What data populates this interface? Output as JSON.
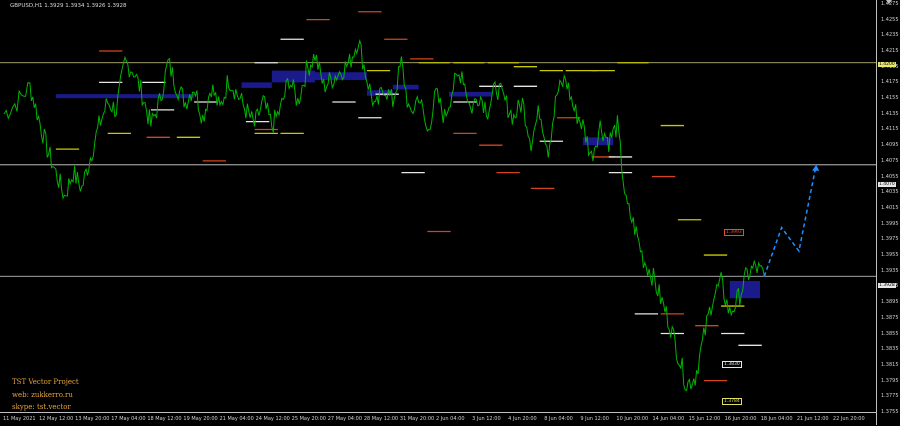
{
  "symbol_info": "GBPUSD,H1  1.3929 1.3934 1.3926 1.3928",
  "credits": [
    "TST Vector Project",
    "web: zukkerro.ru",
    "skype: tst.vector"
  ],
  "price_labels": [
    "1.4275",
    "1.4255",
    "1.4235",
    "1.4215",
    "1.4195",
    "1.4175",
    "1.4155",
    "1.4135",
    "1.4115",
    "1.4095",
    "1.4075",
    "1.4055",
    "1.4035",
    "1.4015",
    "1.3995",
    "1.3975",
    "1.3955",
    "1.3935",
    "1.3915",
    "1.3895",
    "1.3875",
    "1.3855",
    "1.3835",
    "1.3815",
    "1.3795",
    "1.3775",
    "1.3755"
  ],
  "time_labels": [
    "11 May 2021",
    "12 May 12:00",
    "13 May 20:00",
    "17 May 04:00",
    "18 May 12:00",
    "19 May 20:00",
    "21 May 04:00",
    "24 May 12:00",
    "25 May 20:00",
    "27 May 04:00",
    "28 May 12:00",
    "31 May 20:00",
    "2 Jun 04:00",
    "3 Jun 12:00",
    "4 Jun 20:00",
    "8 Jun 04:00",
    "9 Jun 12:00",
    "10 Jun 20:00",
    "14 Jun 04:00",
    "15 Jun 12:00",
    "16 Jun 20:00",
    "18 Jun 04:00",
    "21 Jun 12:00",
    "22 Jun 20:00"
  ],
  "badges": {
    "upper_line": "1.4200",
    "middle_line": "1.4070",
    "current": "1.3928",
    "target_red": "1.3993",
    "target_white": "1.3830",
    "target_yellow": "1.3784"
  },
  "colors": {
    "price": "#00b400",
    "forecast": "#1e90ff",
    "zone": "#1a1a8c",
    "level_red": "#d2451e",
    "level_yellow": "#c8c800",
    "level_white": "#e6e6e6",
    "hline": "#d9d9d9",
    "hline_yellow": "#d4d48a"
  },
  "chart_data": {
    "type": "line",
    "symbol": "GBPUSD",
    "timeframe": "H1",
    "ylim": [
      1.3755,
      1.428
    ],
    "x_range": [
      "11 May 2021",
      "22 Jun 2021"
    ],
    "horizontal_lines": [
      1.42,
      1.407,
      1.3928
    ],
    "price_path_points": [
      [
        0,
        1.4135
      ],
      [
        3,
        1.415
      ],
      [
        6,
        1.417
      ],
      [
        8,
        1.413
      ],
      [
        10,
        1.409
      ],
      [
        12,
        1.406
      ],
      [
        14,
        1.403
      ],
      [
        16,
        1.406
      ],
      [
        18,
        1.404
      ],
      [
        20,
        1.408
      ],
      [
        22,
        1.412
      ],
      [
        24,
        1.415
      ],
      [
        26,
        1.414
      ],
      [
        28,
        1.42
      ],
      [
        30,
        1.419
      ],
      [
        32,
        1.416
      ],
      [
        34,
        1.412
      ],
      [
        36,
        1.415
      ],
      [
        38,
        1.42
      ],
      [
        40,
        1.417
      ],
      [
        42,
        1.415
      ],
      [
        44,
        1.417
      ],
      [
        46,
        1.413
      ],
      [
        48,
        1.417
      ],
      [
        50,
        1.414
      ],
      [
        52,
        1.418
      ],
      [
        54,
        1.416
      ],
      [
        56,
        1.414
      ],
      [
        58,
        1.412
      ],
      [
        60,
        1.415
      ],
      [
        62,
        1.412
      ],
      [
        64,
        1.414
      ],
      [
        66,
        1.418
      ],
      [
        68,
        1.415
      ],
      [
        70,
        1.419
      ],
      [
        72,
        1.421
      ],
      [
        74,
        1.417
      ],
      [
        76,
        1.418
      ],
      [
        78,
        1.419
      ],
      [
        80,
        1.42
      ],
      [
        82,
        1.423
      ],
      [
        84,
        1.418
      ],
      [
        86,
        1.414
      ],
      [
        88,
        1.417
      ],
      [
        90,
        1.415
      ],
      [
        92,
        1.42
      ],
      [
        94,
        1.413
      ],
      [
        96,
        1.416
      ],
      [
        98,
        1.411
      ],
      [
        100,
        1.416
      ],
      [
        102,
        1.413
      ],
      [
        104,
        1.417
      ],
      [
        106,
        1.419
      ],
      [
        108,
        1.414
      ],
      [
        110,
        1.416
      ],
      [
        112,
        1.414
      ],
      [
        114,
        1.417
      ],
      [
        116,
        1.415
      ],
      [
        118,
        1.413
      ],
      [
        120,
        1.415
      ],
      [
        122,
        1.41
      ],
      [
        124,
        1.414
      ],
      [
        126,
        1.409
      ],
      [
        128,
        1.416
      ],
      [
        130,
        1.418
      ],
      [
        132,
        1.414
      ],
      [
        134,
        1.412
      ],
      [
        136,
        1.408
      ],
      [
        138,
        1.412
      ],
      [
        140,
        1.41
      ],
      [
        142,
        1.412
      ],
      [
        144,
        1.402
      ],
      [
        146,
        1.399
      ],
      [
        148,
        1.395
      ],
      [
        150,
        1.393
      ],
      [
        152,
        1.39
      ],
      [
        154,
        1.387
      ],
      [
        156,
        1.383
      ],
      [
        158,
        1.379
      ],
      [
        160,
        1.38
      ],
      [
        162,
        1.385
      ],
      [
        164,
        1.39
      ],
      [
        166,
        1.392
      ],
      [
        168,
        1.388
      ],
      [
        170,
        1.39
      ],
      [
        172,
        1.393
      ],
      [
        174,
        1.394
      ],
      [
        176,
        1.3928
      ]
    ],
    "forecast_path": [
      [
        176,
        1.3928
      ],
      [
        180,
        1.399
      ],
      [
        184,
        1.396
      ],
      [
        188,
        1.407
      ]
    ],
    "zones": [
      {
        "x0": 12,
        "x1": 44,
        "y_top": 1.416,
        "y_bottom": 1.4155
      },
      {
        "x0": 55,
        "x1": 62,
        "y_top": 1.4175,
        "y_bottom": 1.4168
      },
      {
        "x0": 62,
        "x1": 72,
        "y_top": 1.419,
        "y_bottom": 1.4175
      },
      {
        "x0": 72,
        "x1": 84,
        "y_top": 1.4188,
        "y_bottom": 1.4178
      },
      {
        "x0": 84,
        "x1": 90,
        "y_top": 1.4165,
        "y_bottom": 1.4158
      },
      {
        "x0": 90,
        "x1": 96,
        "y_top": 1.4172,
        "y_bottom": 1.4166
      },
      {
        "x0": 103,
        "x1": 113,
        "y_top": 1.4163,
        "y_bottom": 1.4157
      },
      {
        "x0": 134,
        "x1": 141,
        "y_top": 1.4105,
        "y_bottom": 1.4095
      },
      {
        "x0": 168,
        "x1": 175,
        "y_top": 1.3922,
        "y_bottom": 1.39
      }
    ],
    "levels": {
      "red": [
        [
          22,
          28,
          1.4215
        ],
        [
          33,
          39,
          1.4105
        ],
        [
          46,
          52,
          1.4075
        ],
        [
          58,
          64,
          1.4115
        ],
        [
          70,
          76,
          1.4255
        ],
        [
          82,
          88,
          1.4265
        ],
        [
          88,
          94,
          1.423
        ],
        [
          94,
          100,
          1.4205
        ],
        [
          98,
          104,
          1.3985
        ],
        [
          104,
          110,
          1.411
        ],
        [
          110,
          116,
          1.4095
        ],
        [
          114,
          120,
          1.406
        ],
        [
          122,
          128,
          1.404
        ],
        [
          128,
          134,
          1.413
        ],
        [
          136,
          142,
          1.408
        ],
        [
          150,
          156,
          1.4055
        ],
        [
          152,
          158,
          1.388
        ],
        [
          160,
          166,
          1.3865
        ],
        [
          162,
          168,
          1.3795
        ]
      ],
      "yellow": [
        [
          12,
          18,
          1.409
        ],
        [
          24,
          30,
          1.411
        ],
        [
          40,
          46,
          1.4105
        ],
        [
          58,
          64,
          1.411
        ],
        [
          64,
          70,
          1.411
        ],
        [
          84,
          90,
          1.419
        ],
        [
          96,
          104,
          1.42
        ],
        [
          104,
          112,
          1.42
        ],
        [
          112,
          120,
          1.42
        ],
        [
          118,
          124,
          1.4195
        ],
        [
          124,
          130,
          1.419
        ],
        [
          130,
          138,
          1.419
        ],
        [
          136,
          142,
          1.419
        ],
        [
          142,
          150,
          1.42
        ],
        [
          152,
          158,
          1.412
        ],
        [
          156,
          162,
          1.4
        ],
        [
          162,
          168,
          1.3955
        ],
        [
          166,
          172,
          1.389
        ]
      ],
      "white": [
        [
          22,
          28,
          1.4175
        ],
        [
          32,
          38,
          1.4175
        ],
        [
          34,
          40,
          1.414
        ],
        [
          44,
          50,
          1.415
        ],
        [
          56,
          62,
          1.4125
        ],
        [
          58,
          64,
          1.42
        ],
        [
          64,
          70,
          1.423
        ],
        [
          76,
          82,
          1.415
        ],
        [
          82,
          88,
          1.413
        ],
        [
          86,
          92,
          1.416
        ],
        [
          92,
          98,
          1.406
        ],
        [
          104,
          110,
          1.415
        ],
        [
          110,
          116,
          1.417
        ],
        [
          118,
          124,
          1.417
        ],
        [
          124,
          130,
          1.41
        ],
        [
          140,
          146,
          1.406
        ],
        [
          140,
          146,
          1.408
        ],
        [
          146,
          152,
          1.388
        ],
        [
          152,
          158,
          1.3855
        ],
        [
          166,
          172,
          1.3855
        ],
        [
          170,
          176,
          1.384
        ]
      ]
    }
  }
}
